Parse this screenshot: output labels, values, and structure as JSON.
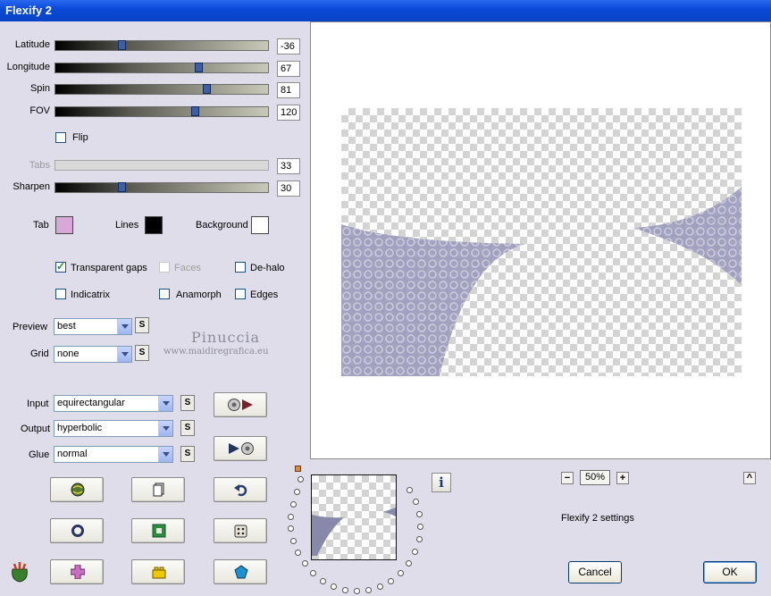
{
  "window": {
    "title": "Flexify 2"
  },
  "sliders": [
    {
      "label": "Latitude",
      "value": "-36",
      "position": 0.31,
      "enabled": true
    },
    {
      "label": "Longitude",
      "value": "67",
      "position": 0.67,
      "enabled": true
    },
    {
      "label": "Spin",
      "value": "81",
      "position": 0.71,
      "enabled": true
    },
    {
      "label": "FOV",
      "value": "120",
      "position": 0.66,
      "enabled": true
    },
    {
      "label": "Tabs",
      "value": "33",
      "position": 0.0,
      "enabled": false
    },
    {
      "label": "Sharpen",
      "value": "30",
      "position": 0.31,
      "enabled": true
    }
  ],
  "flip": {
    "label": "Flip",
    "checked": false
  },
  "colors": {
    "tab": {
      "label": "Tab",
      "color": "#d8a8d8"
    },
    "lines": {
      "label": "Lines",
      "color": "#000000"
    },
    "background": {
      "label": "Background",
      "color": "#ffffff"
    }
  },
  "options": {
    "transparent_gaps": {
      "label": "Transparent gaps",
      "checked": true
    },
    "faces": {
      "label": "Faces",
      "checked": false
    },
    "de_halo": {
      "label": "De-halo",
      "checked": false
    },
    "indicatrix": {
      "label": "Indicatrix",
      "checked": false
    },
    "anamorph": {
      "label": "Anamorph",
      "checked": false
    },
    "edges": {
      "label": "Edges",
      "checked": false
    }
  },
  "dropdowns": {
    "preview": {
      "label": "Preview",
      "value": "best"
    },
    "grid": {
      "label": "Grid",
      "value": "none"
    },
    "input": {
      "label": "Input",
      "value": "equirectangular"
    },
    "output": {
      "label": "Output",
      "value": "hyperbolic"
    },
    "glue": {
      "label": "Glue",
      "value": "normal"
    }
  },
  "watermark": {
    "name": "Pinuccia",
    "site": "www.maidiregrafica.eu"
  },
  "zoom": {
    "value": "50%",
    "minus": "−",
    "plus": "+"
  },
  "settings_text": "Flexify 2 settings",
  "buttons": {
    "cancel": "Cancel",
    "ok": "OK",
    "s": "S",
    "info": "i",
    "collapse": "^"
  },
  "accent_colors": {
    "titlebar": "#0a4ad8",
    "shape": "#8a8aa8"
  }
}
